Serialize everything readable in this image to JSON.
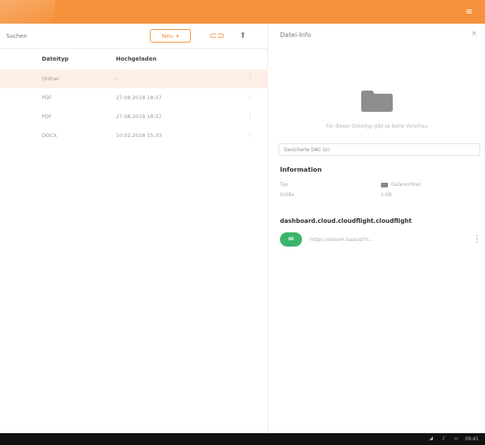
{
  "search": {
    "placeholder": "Suchen"
  },
  "toolbar": {
    "new_label": "Neu",
    "new_chevron": "▾",
    "link_icon": "⊂⊃",
    "upload_icon": "⬆"
  },
  "table": {
    "headers": {
      "type": "Dateityp",
      "uploaded": "Hochgeladen"
    },
    "rows": [
      {
        "type": "Ordner",
        "date": "-",
        "menu": "⋮"
      },
      {
        "type": "PDF",
        "date": "27.08.2018 18:37",
        "menu": "⋮"
      },
      {
        "type": "PDF",
        "date": "27.08.2018 18:37",
        "menu": "⋮"
      },
      {
        "type": "DOCX",
        "date": "10.02.2018 15:33",
        "menu": "⋮"
      }
    ]
  },
  "panel": {
    "title": "Datei-Info",
    "close": "×",
    "preview_message": "Für diesen Dateityp gibt es keine Vorschau",
    "tag_value": "Gesicherte DAC (U)",
    "info_heading": "Information",
    "info": [
      {
        "key": "Typ",
        "value": "Datenordner"
      },
      {
        "key": "Größe",
        "value": "1 KB"
      }
    ],
    "share_heading": "dashboard.cloud.cloudflight.cloudflight",
    "share_url": "https://steam.saas/d?h...",
    "share_menu": "⋮",
    "link_badge": "∞"
  },
  "taskbar": {
    "time": "09:41",
    "tray_icons": [
      "wifi-icon",
      "volume-icon",
      "battery-icon"
    ],
    "tray_glyphs": [
      "◢",
      "♪",
      "▭"
    ]
  },
  "topbar": {
    "menu_glyph": "≡"
  },
  "colors": {
    "accent": "#f5923b",
    "link_green": "#3bb56b",
    "selected_row": "#fdefe5",
    "taskbar": "#111111"
  }
}
